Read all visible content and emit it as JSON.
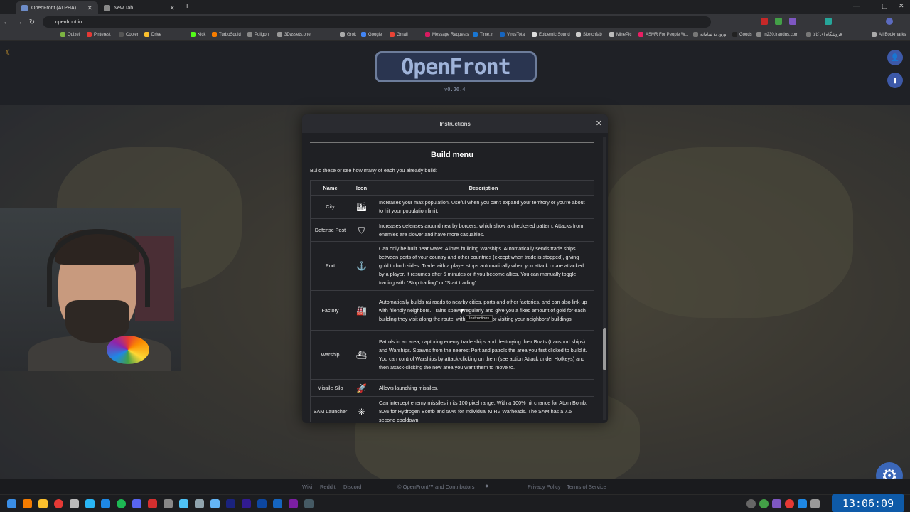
{
  "browser": {
    "tabs": [
      {
        "title": "OpenFront (ALPHA)",
        "active": true
      },
      {
        "title": "New Tab",
        "active": false
      }
    ],
    "url": "openfront.io",
    "all_bookmarks": "All Bookmarks",
    "bookmarks": [
      "Quixel",
      "Pinterest",
      "Cooler",
      "Drive",
      "Kick",
      "TurboSquid",
      "Poligon",
      "3Dassets.one",
      "Grok",
      "Google",
      "Gmail",
      "Message Requests",
      "Time.ir",
      "VirusTotal",
      "Epidemic Sound",
      "Sketchfab",
      "MinePic",
      "ASMR For People W...",
      "ورود به سامانه",
      "Goods",
      "ln230.irandns.com",
      "فروشگاه ای کالا"
    ]
  },
  "page": {
    "logo": "OpenFront",
    "version": "v0.26.4"
  },
  "modal": {
    "title": "Instructions",
    "close": "✕",
    "section_title": "Build menu",
    "intro": "Build these or see how many of each you already build:",
    "columns": {
      "name": "Name",
      "icon": "Icon",
      "description": "Description"
    },
    "rows": [
      {
        "name": "City",
        "icon": "🏙",
        "description": "Increases your max population. Useful when you can't expand your territory or you're about to hit your population limit."
      },
      {
        "name": "Defense Post",
        "icon": "⛉",
        "description": "Increases defenses around nearby borders, which show a checkered pattern. Attacks from enemies are slower and have more casualties."
      },
      {
        "name": "Port",
        "icon": "⚓",
        "description": "Can only be built near water. Allows building Warships. Automatically sends trade ships between ports of your country and other countries (except when trade is stopped), giving gold to both sides. Trade with a player stops automatically when you attack or are attacked by a player. It resumes after 5 minutes or if you become allies. You can manually toggle trading with \"Stop trading\" or \"Start trading\"."
      },
      {
        "name": "Factory",
        "icon": "🏭",
        "description": "Automatically builds railroads to nearby cities, ports and other factories, and can also link up with friendly neighbors. Trains spawn regularly and give you a fixed amount of gold for each building they visit along the route, with extra gold for visiting your neighbors' buildings."
      },
      {
        "name": "Warship",
        "icon": "⛴",
        "description": "Patrols in an area, capturing enemy trade ships and destroying their Boats (transport ships) and Warships. Spawns from the nearest Port and patrols the area you first clicked to build it. You can control Warships by attack-clicking on them (see action Attack under Hotkeys) and then attack-clicking the new area you want them to move to."
      },
      {
        "name": "Missile Silo",
        "icon": "🚀",
        "description": "Allows launching missiles."
      },
      {
        "name": "SAM Launcher",
        "icon": "⛯",
        "description": "Can intercept enemy missiles in its 100 pixel range. With a 100% hit chance for Atom Bomb, 80% for Hydrogen Bomb and 50% for individual MIRV Warheads. The SAM has a 7.5 second cooldown."
      }
    ],
    "tooltip": "Instructions"
  },
  "footer": {
    "wiki": "Wiki",
    "reddit": "Reddit",
    "discord": "Discord",
    "copyright": "© OpenFront™ and Contributors",
    "privacy": "Privacy Policy",
    "terms": "Terms of Service"
  },
  "taskbar": {
    "clock": "13:06:09"
  },
  "colors": {
    "accent": "#3b67b8",
    "modal_bg": "#1f2024",
    "clock_bg": "#0e5aa8"
  }
}
